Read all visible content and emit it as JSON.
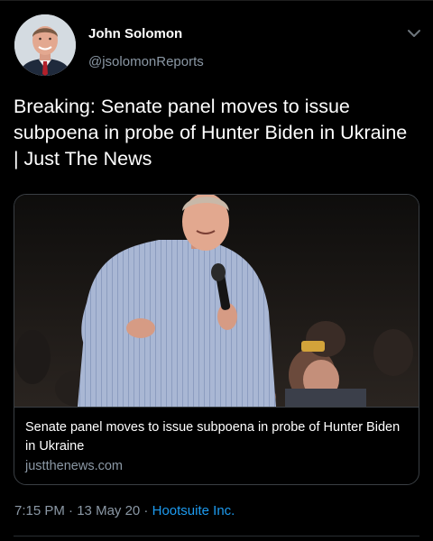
{
  "tweet": {
    "author": {
      "name": "John Solomon",
      "handle": "@jsolomonReports"
    },
    "text": "Breaking: Senate panel moves to issue subpoena in probe of Hunter Biden in Ukraine | Just The News",
    "card": {
      "title": "Senate panel moves to issue subpoena in probe of Hunter Biden in Ukraine",
      "domain": "justthenews.com"
    },
    "meta": {
      "time": "7:15 PM",
      "separator1": " · ",
      "date": "13 May 20",
      "separator2": " · ",
      "source": "Hootsuite Inc."
    }
  },
  "icons": {
    "menu": "chevron-down-icon"
  },
  "colors": {
    "background": "#000000",
    "text": "#ffffff",
    "secondary_text": "#8b98a5",
    "link": "#1d9bf0",
    "border": "#3a3f44"
  }
}
